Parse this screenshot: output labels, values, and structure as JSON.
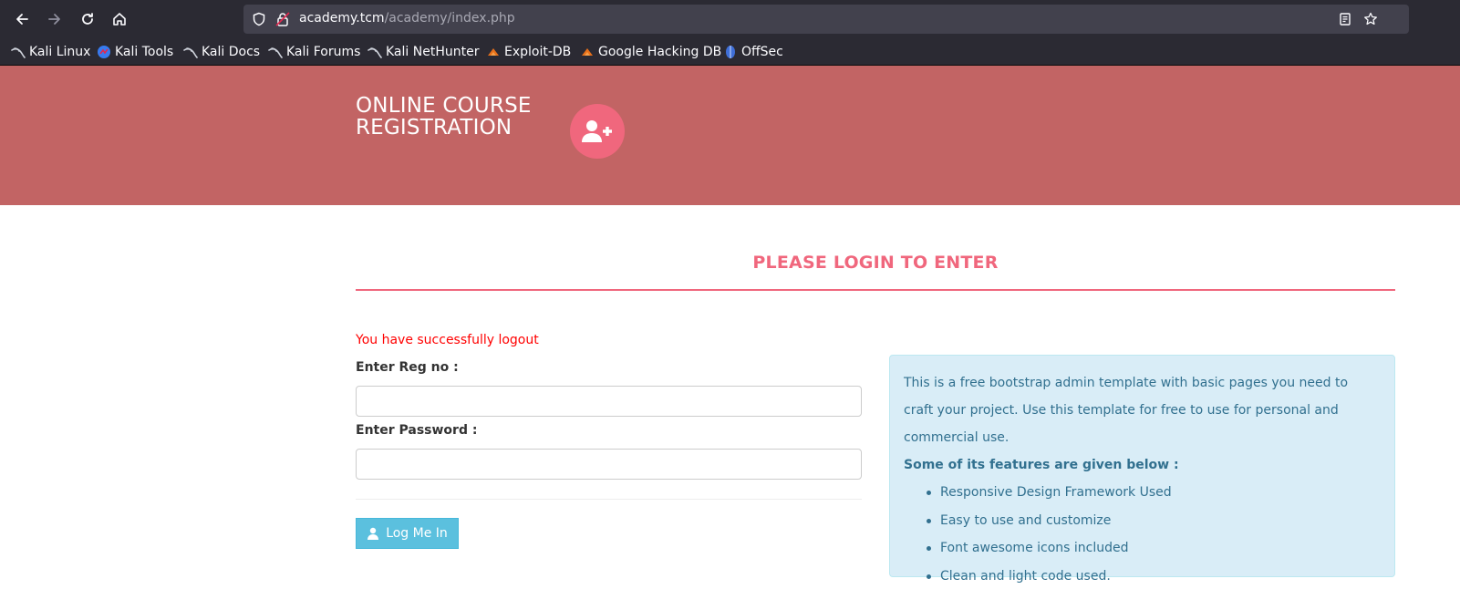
{
  "browser": {
    "url_host": "academy.tcm",
    "url_path": "/academy/index.php"
  },
  "bookmarks": [
    {
      "label": "Kali Linux",
      "icon": "kali-dragon-icon"
    },
    {
      "label": "Kali Tools",
      "icon": "kali-tools-icon"
    },
    {
      "label": "Kali Docs",
      "icon": "kali-dragon-icon"
    },
    {
      "label": "Kali Forums",
      "icon": "kali-dragon-icon"
    },
    {
      "label": "Kali NetHunter",
      "icon": "kali-dragon-icon"
    },
    {
      "label": "Exploit-DB",
      "icon": "exploit-db-icon"
    },
    {
      "label": "Google Hacking DB",
      "icon": "exploit-db-icon"
    },
    {
      "label": "OffSec",
      "icon": "offsec-icon"
    }
  ],
  "header": {
    "title_line1": "ONLINE COURSE",
    "title_line2": "REGISTRATION",
    "logo_icon": "user-plus-icon",
    "bg_color": "#c26464",
    "accent_color": "#f0677d"
  },
  "main": {
    "page_title": "PLEASE LOGIN TO ENTER",
    "alert": "You have successfully logout",
    "reg_label": "Enter Reg no :",
    "reg_value": "",
    "password_label": "Enter Password :",
    "password_value": "",
    "login_button": "Log Me In"
  },
  "info": {
    "intro": "This is a free bootstrap admin template with basic pages you need to craft your project. Use this template for free to use for personal and commercial use.",
    "features_title": "Some of its features are given below :",
    "features": [
      "Responsive Design Framework Used",
      "Easy to use and customize",
      "Font awesome icons included",
      "Clean and light code used."
    ]
  }
}
